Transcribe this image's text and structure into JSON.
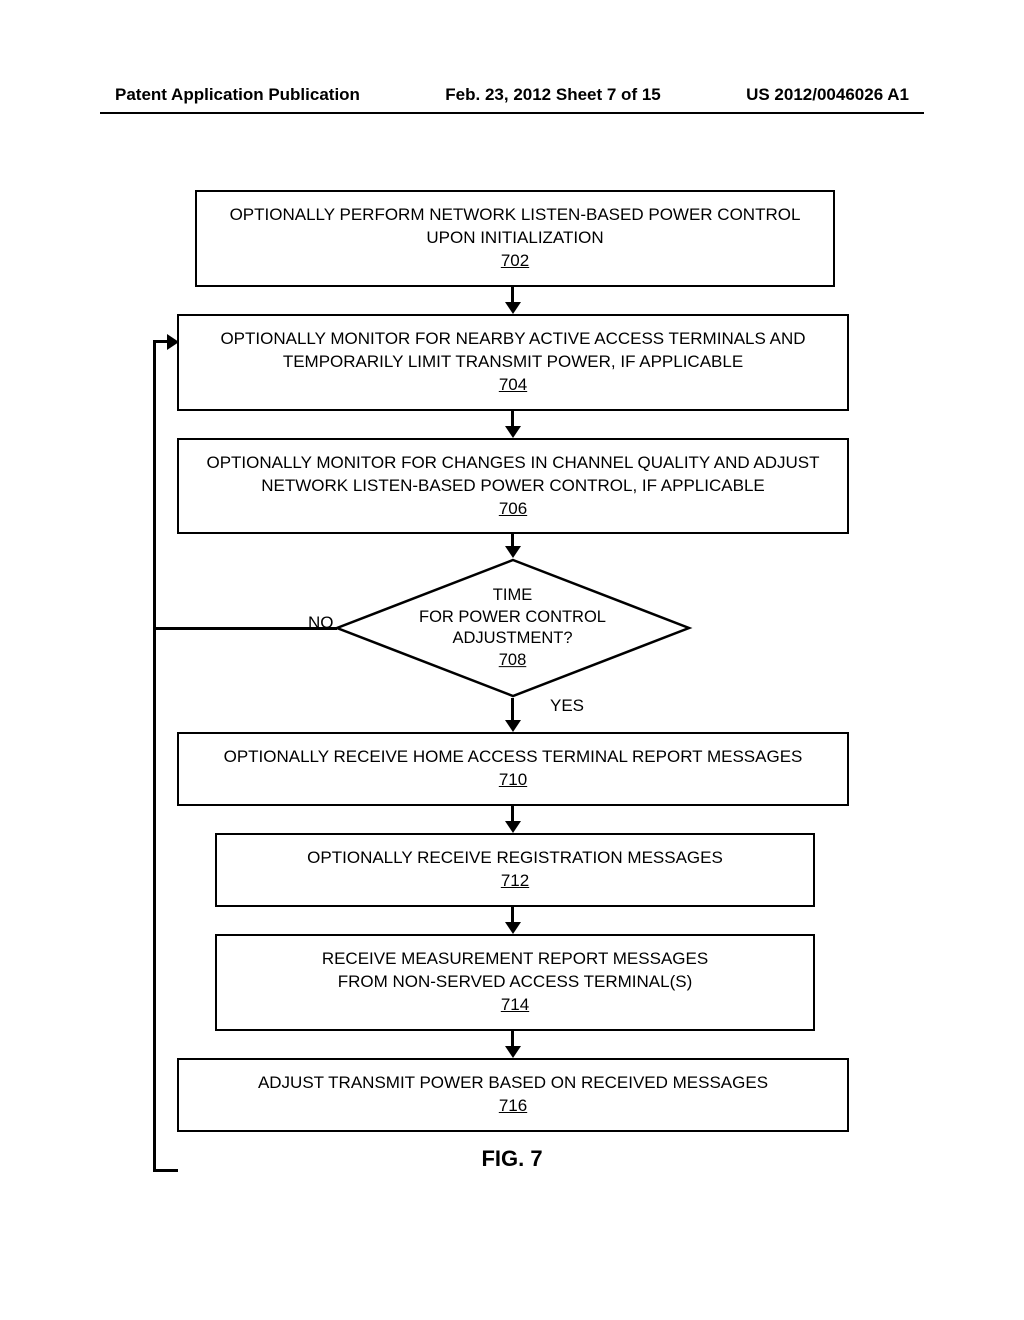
{
  "header": {
    "left": "Patent Application Publication",
    "center": "Feb. 23, 2012  Sheet 7 of 15",
    "right": "US 2012/0046026 A1"
  },
  "boxes": {
    "b702_text": "OPTIONALLY PERFORM NETWORK LISTEN-BASED POWER CONTROL UPON INITIALIZATION",
    "b702_num": "702",
    "b704_text": "OPTIONALLY MONITOR FOR NEARBY ACTIVE ACCESS TERMINALS AND TEMPORARILY LIMIT TRANSMIT POWER, IF APPLICABLE",
    "b704_num": "704",
    "b706_text": "OPTIONALLY MONITOR FOR CHANGES IN CHANNEL QUALITY AND ADJUST NETWORK LISTEN-BASED POWER CONTROL, IF APPLICABLE",
    "b706_num": "706",
    "b708_text1": "TIME",
    "b708_text2": "FOR POWER CONTROL",
    "b708_text3": "ADJUSTMENT?",
    "b708_num": "708",
    "b708_no": "NO",
    "b708_yes": "YES",
    "b710_text": "OPTIONALLY RECEIVE HOME ACCESS TERMINAL REPORT MESSAGES",
    "b710_num": "710",
    "b712_text": "OPTIONALLY RECEIVE REGISTRATION MESSAGES",
    "b712_num": "712",
    "b714_text1": "RECEIVE MEASUREMENT REPORT MESSAGES",
    "b714_text2": "FROM NON-SERVED ACCESS TERMINAL(S)",
    "b714_num": "714",
    "b716_text": "ADJUST TRANSMIT POWER BASED ON RECEIVED MESSAGES",
    "b716_num": "716"
  },
  "caption": "FIG. 7",
  "chart_data": {
    "type": "flowchart",
    "nodes": [
      {
        "id": "702",
        "type": "process",
        "text": "OPTIONALLY PERFORM NETWORK LISTEN-BASED POWER CONTROL UPON INITIALIZATION"
      },
      {
        "id": "704",
        "type": "process",
        "text": "OPTIONALLY MONITOR FOR NEARBY ACTIVE ACCESS TERMINALS AND TEMPORARILY LIMIT TRANSMIT POWER, IF APPLICABLE"
      },
      {
        "id": "706",
        "type": "process",
        "text": "OPTIONALLY MONITOR FOR CHANGES IN CHANNEL QUALITY AND ADJUST NETWORK LISTEN-BASED POWER CONTROL, IF APPLICABLE"
      },
      {
        "id": "708",
        "type": "decision",
        "text": "TIME FOR POWER CONTROL ADJUSTMENT?"
      },
      {
        "id": "710",
        "type": "process",
        "text": "OPTIONALLY RECEIVE HOME ACCESS TERMINAL REPORT MESSAGES"
      },
      {
        "id": "712",
        "type": "process",
        "text": "OPTIONALLY RECEIVE REGISTRATION MESSAGES"
      },
      {
        "id": "714",
        "type": "process",
        "text": "RECEIVE MEASUREMENT REPORT MESSAGES FROM NON-SERVED ACCESS TERMINAL(S)"
      },
      {
        "id": "716",
        "type": "process",
        "text": "ADJUST TRANSMIT POWER BASED ON RECEIVED MESSAGES"
      }
    ],
    "edges": [
      {
        "from": "702",
        "to": "704"
      },
      {
        "from": "704",
        "to": "706"
      },
      {
        "from": "706",
        "to": "708"
      },
      {
        "from": "708",
        "to": "704",
        "label": "NO"
      },
      {
        "from": "708",
        "to": "710",
        "label": "YES"
      },
      {
        "from": "710",
        "to": "712"
      },
      {
        "from": "712",
        "to": "714"
      },
      {
        "from": "714",
        "to": "716"
      },
      {
        "from": "716",
        "to": "704"
      }
    ]
  }
}
